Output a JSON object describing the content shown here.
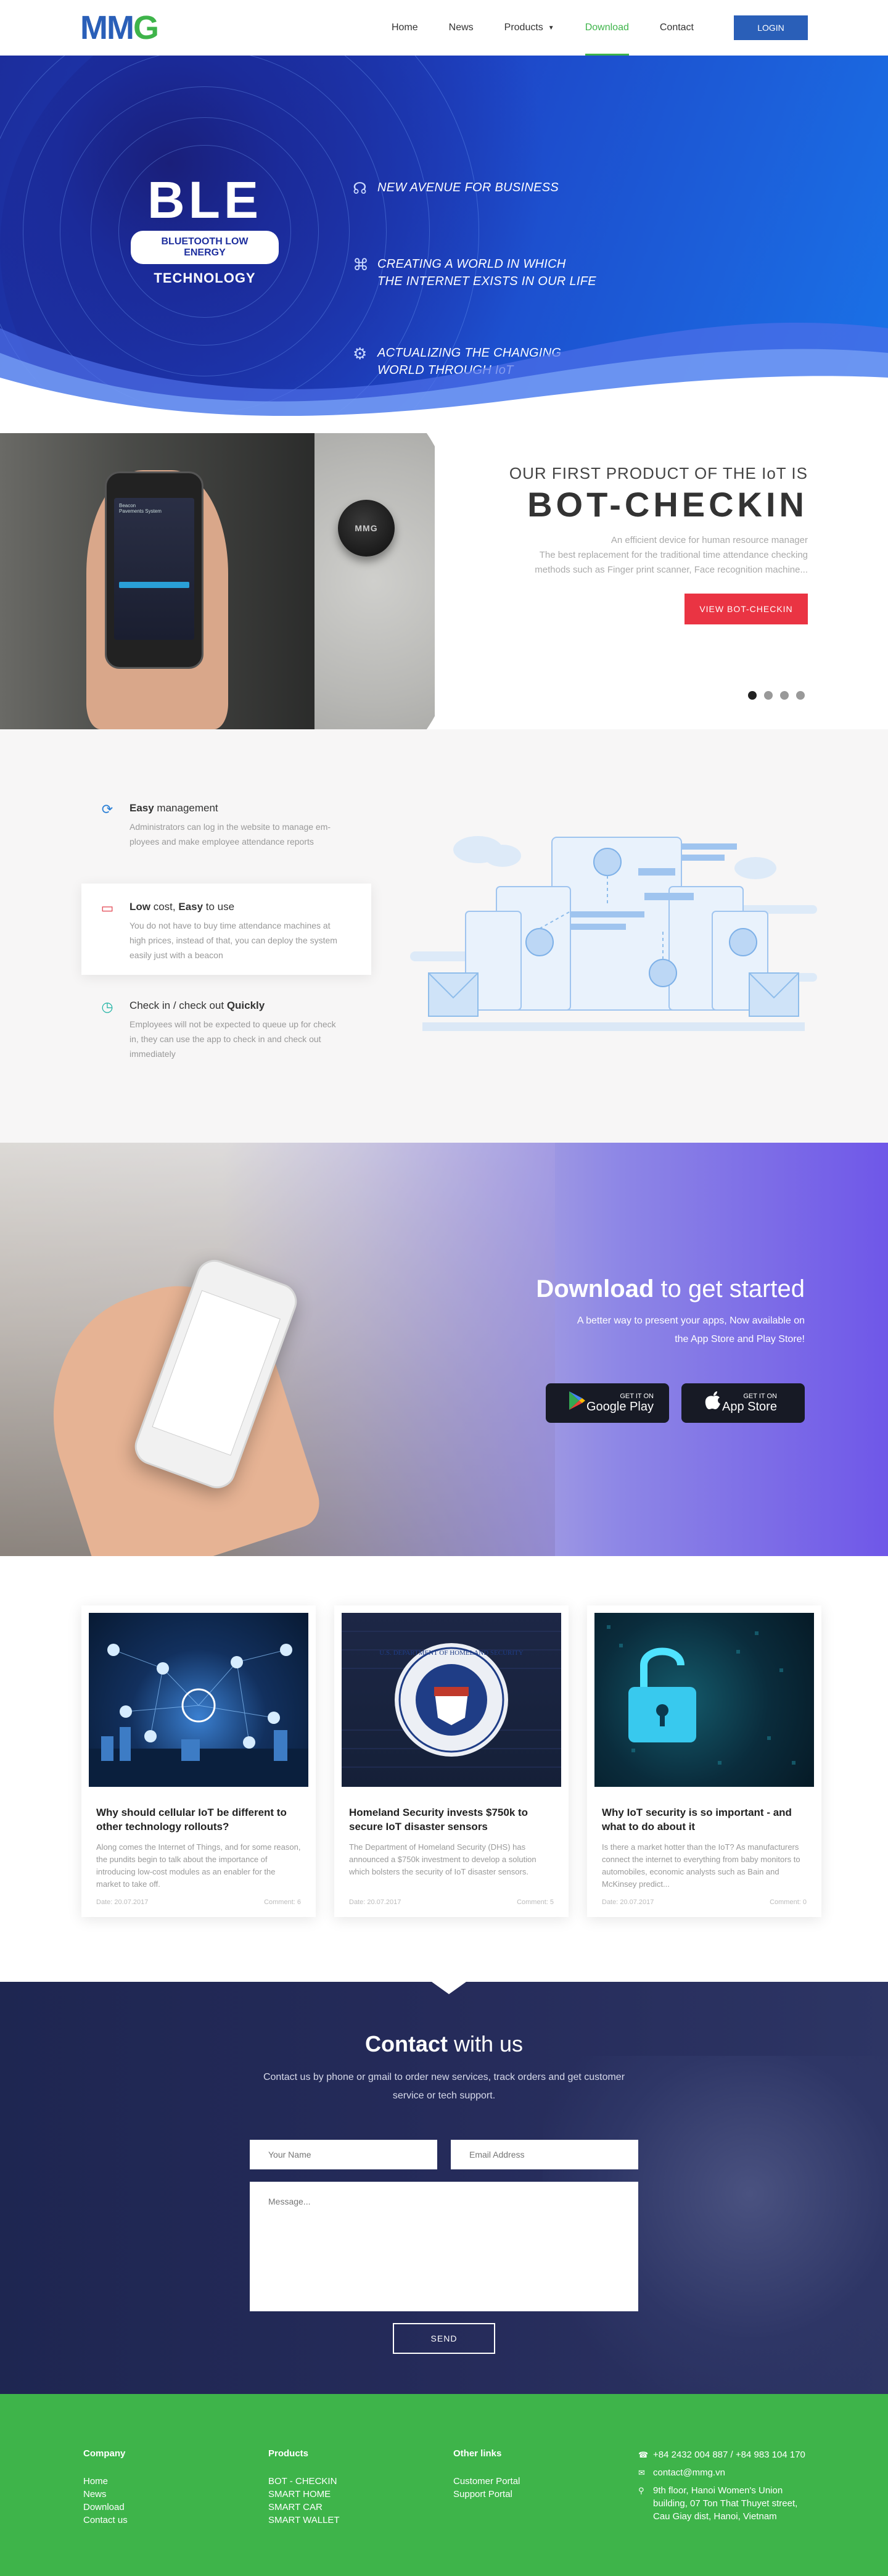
{
  "header": {
    "logo": {
      "m": "MM",
      "g": "G"
    },
    "nav": [
      {
        "label": "Home"
      },
      {
        "label": "News"
      },
      {
        "label": "Products"
      },
      {
        "label": "Download"
      },
      {
        "label": "Contact"
      }
    ],
    "login_label": "LOGIN",
    "colors": {
      "primary": "#2a5fb8",
      "accent": "#3eb44a"
    }
  },
  "hero": {
    "ble_title": "BLE",
    "ble_pill": "BLUETOOTH LOW ENERGY",
    "ble_sub": "TECHNOLOGY",
    "features": [
      {
        "icon": "satellite-icon",
        "text": "NEW AVENUE FOR BUSINESS"
      },
      {
        "icon": "network-icon",
        "line1": "CREATING A WORLD IN WHICH",
        "line2": "THE INTERNET EXISTS IN OUR LIFE"
      },
      {
        "icon": "gear-icon",
        "line1": "ACTUALIZING THE CHANGING",
        "line2": "WORLD THROUGH IoT"
      }
    ]
  },
  "product": {
    "subtitle": "OUR FIRST PRODUCT OF THE IoT IS",
    "title": "BOT-CHECKIN",
    "desc_line1": "An efficient device for human resource manager",
    "desc_line2": "The best replacement for the traditional time attendance checking",
    "desc_line3": "methods such as Finger print scanner, Face recognition machine...",
    "cta": "VIEW BOT-CHECKIN",
    "device_label": "MMG",
    "phone_app_title": "Beacon",
    "phone_app_sub": "Pavements System",
    "carousel": {
      "total": 4,
      "active": 1
    }
  },
  "features": [
    {
      "icon": "sync-icon",
      "bold": "Easy",
      "rest": " management",
      "desc1": "Administrators can log in the website to manage em-",
      "desc2": "ployees and make employee attendance reports",
      "desc3": ""
    },
    {
      "icon": "wallet-icon",
      "bold1": "Low",
      "mid": " cost, ",
      "bold2": "Easy",
      "rest": " to use",
      "desc1": "You do not have to buy time attendance machines at",
      "desc2": "high prices, instead of that, you can deploy the system",
      "desc3": "easily just with a beacon"
    },
    {
      "icon": "clock-icon",
      "pre": "Check in / check out ",
      "bold": "Quickly",
      "desc1": "Employees will not be expected to queue up for check",
      "desc2": "in, they can use the app to check in and check out",
      "desc3": "immediately"
    }
  ],
  "download": {
    "title_bold": "Download",
    "title_rest": " to get started",
    "desc_line1": "A better way to present your apps, Now available on",
    "desc_line2": "the App Store and Play Store!",
    "stores": [
      {
        "icon": "google-play-icon",
        "small": "GET IT ON",
        "name": "Google Play"
      },
      {
        "icon": "apple-icon",
        "small": "GET IT ON",
        "name": "App Store"
      }
    ]
  },
  "news": [
    {
      "title_line1": "Why should cellular IoT be different to",
      "title_line2": "other technology rollouts?",
      "summary": "Along comes the Internet of Things, and for some reason, the pundits begin to talk about the importance of introducing low-cost modules as an enabler for the market to take off.",
      "date": "Date: 20.07.2017",
      "comments": "Comment: 6"
    },
    {
      "title_line1": "Homeland Security invests $750k to",
      "title_line2": "secure IoT disaster sensors",
      "summary": "The Department of Homeland Security (DHS) has announced a $750k investment to develop a solution which bolsters the security of IoT disaster sensors.",
      "date": "Date: 20.07.2017",
      "comments": "Comment: 5",
      "seal_text": "U.S. DEPARTMENT OF HOMELAND SECURITY"
    },
    {
      "title_line1": "Why IoT security is so important - and",
      "title_line2": "what to do about it",
      "summary": "Is there a market hotter than the IoT? As manufacturers connect the internet to everything from baby monitors to automobiles, economic analysts such as Bain and McKinsey predict...",
      "date": "Date: 20.07.2017",
      "comments": "Comment: 0"
    }
  ],
  "contact": {
    "title_bold": "Contact",
    "title_rest": " with us",
    "desc": "Contact us by phone or gmail to order new services, track orders and get customer service or tech support.",
    "name_placeholder": "Your Name",
    "email_placeholder": "Email Address",
    "message_placeholder": "Message...",
    "send_label": "SEND"
  },
  "footer": {
    "company": {
      "title": "Company",
      "links": [
        "Home",
        "News",
        "Download",
        "Contact us"
      ]
    },
    "products": {
      "title": "Products",
      "links": [
        "BOT - CHECKIN",
        "SMART HOME",
        "SMART CAR",
        "SMART WALLET"
      ]
    },
    "other": {
      "title": "Other links",
      "links": [
        "Customer Portal",
        "Support Portal"
      ]
    },
    "phone": "+84 2432 004 887 / +84 983 104 170",
    "email": "contact@mmg.vn",
    "address_line1": "9th floor, Hanoi Women's Union",
    "address_line2": "building, 07 Ton That Thuyet street,",
    "address_line3": "Cau Giay dist, Hanoi, Vietnam"
  }
}
